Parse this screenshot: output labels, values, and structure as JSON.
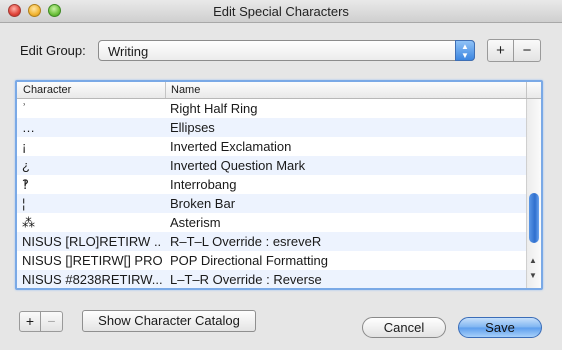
{
  "window": {
    "title": "Edit Special Characters"
  },
  "group": {
    "label": "Edit Group:",
    "selected": "Writing"
  },
  "group_buttons": {
    "add": "+",
    "remove": "−"
  },
  "table": {
    "columns": [
      "Character",
      "Name"
    ],
    "rows": [
      {
        "char": "ʾ",
        "name": "Right Half Ring"
      },
      {
        "char": "…",
        "name": "Ellipses"
      },
      {
        "char": "¡",
        "name": "Inverted Exclamation"
      },
      {
        "char": "¿",
        "name": "Inverted Question Mark"
      },
      {
        "char": "‽",
        "name": "Interrobang"
      },
      {
        "char": "¦",
        "name": "Broken Bar"
      },
      {
        "char": "⁂",
        "name": "Asterism"
      },
      {
        "char": "NISUS [RLO]RETIRW ...",
        "name": "R–T–L Override : esreveR"
      },
      {
        "char": "NISUS []RETIRW[] PRO",
        "name": "POP Directional Formatting"
      },
      {
        "char": "NISUS #8238RETIRW...",
        "name": "L–T–R Override : Reverse"
      }
    ]
  },
  "bottom": {
    "add": "+",
    "remove": "−",
    "catalog": "Show Character Catalog",
    "cancel": "Cancel",
    "save": "Save"
  }
}
